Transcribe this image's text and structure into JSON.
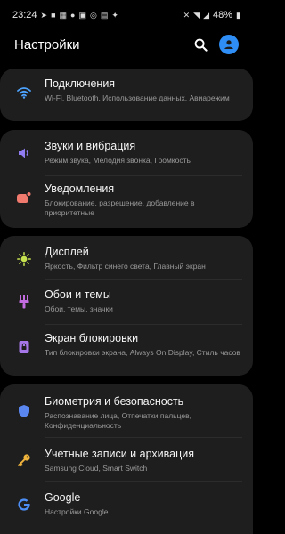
{
  "status_bar": {
    "time": "23:24",
    "battery": "48%"
  },
  "header": {
    "title": "Настройки"
  },
  "items": [
    {
      "label": "Подключения",
      "desc": "Wi-Fi, Bluetooth, Использование данных, Авиарежим",
      "icon": "wifi-icon",
      "color": "#4da3ff"
    },
    {
      "label": "Звуки и вибрация",
      "desc": "Режим звука, Мелодия звонка, Громкость",
      "icon": "speaker-icon",
      "color": "#8e7cf0"
    },
    {
      "label": "Уведомления",
      "desc": "Блокирование, разрешение, добавление в приоритетные",
      "icon": "notification-icon",
      "color": "#f07a6e"
    },
    {
      "label": "Дисплей",
      "desc": "Яркость, Фильтр синего света, Главный экран",
      "icon": "sun-icon",
      "color": "#c6e34f"
    },
    {
      "label": "Обои и темы",
      "desc": "Обои, темы, значки",
      "icon": "brush-icon",
      "color": "#c36be0"
    },
    {
      "label": "Экран блокировки",
      "desc": "Тип блокировки экрана, Always On Display, Стиль часов",
      "icon": "lock-icon",
      "color": "#a577e8"
    },
    {
      "label": "Биометрия и безопасность",
      "desc": "Распознавание лица, Отпечатки пальцев, Конфиденциальность",
      "icon": "shield-icon",
      "color": "#5a86f0"
    },
    {
      "label": "Учетные записи и архивация",
      "desc": "Samsung Cloud, Smart Switch",
      "icon": "key-icon",
      "color": "#f0b43c"
    },
    {
      "label": "Google",
      "desc": "Настройки Google",
      "icon": "google-icon",
      "color": "#4d8ef5"
    }
  ]
}
